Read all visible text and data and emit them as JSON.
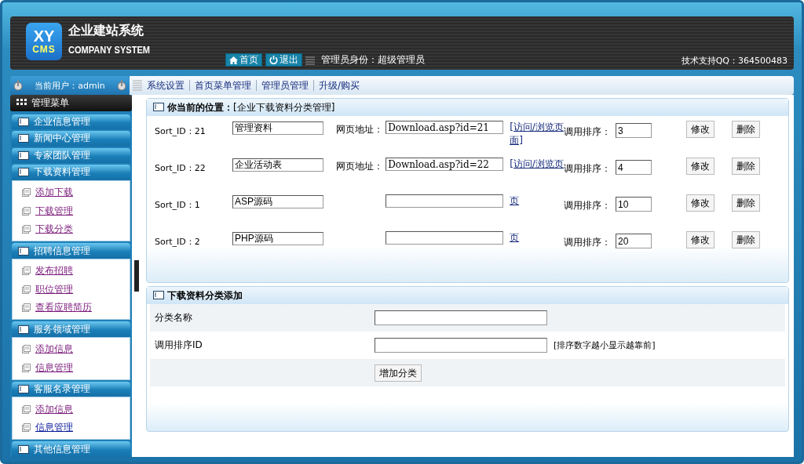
{
  "header": {
    "logo_top": "XY",
    "logo_bottom": "CMS",
    "title": "企业建站系统",
    "subtitle": "COMPANY SYSTEM",
    "buttons": [
      {
        "label": "首页",
        "kind": "home"
      },
      {
        "label": "退出",
        "kind": "power"
      }
    ],
    "admin_role": "管理员身份：超级管理员",
    "support": "技术支持QQ：364500483"
  },
  "current_user": "当前用户：admin",
  "top_nav": [
    "系统设置",
    "首页菜单管理",
    "管理员管理",
    "升级/购买"
  ],
  "sidebar": {
    "title": "管理菜单",
    "groups": [
      {
        "title": "企业信息管理",
        "expanded": false
      },
      {
        "title": "新闻中心管理",
        "expanded": false
      },
      {
        "title": "专家团队管理",
        "expanded": false
      },
      {
        "title": "下载资料管理",
        "expanded": true,
        "items": [
          {
            "label": "添加下载",
            "visited": true
          },
          {
            "label": "下载管理",
            "visited": true
          },
          {
            "label": "下载分类",
            "visited": true
          }
        ]
      },
      {
        "title": "招聘信息管理",
        "expanded": true,
        "items": [
          {
            "label": "发布招聘",
            "visited": true
          },
          {
            "label": "职位管理",
            "visited": true
          },
          {
            "label": "查看应聘简历",
            "visited": true
          }
        ]
      },
      {
        "title": "服务领域管理",
        "expanded": true,
        "items": [
          {
            "label": "添加信息",
            "visited": true
          },
          {
            "label": "信息管理",
            "visited": true
          }
        ]
      },
      {
        "title": "客服名录管理",
        "expanded": true,
        "items": [
          {
            "label": "添加信息",
            "visited": true
          },
          {
            "label": "信息管理",
            "visited": false
          }
        ]
      },
      {
        "title": "其他信息管理",
        "expanded": false
      }
    ]
  },
  "location": {
    "label": "你当前的位置：",
    "path": "[企业下载资料分类管理]"
  },
  "categories": [
    {
      "sort_id": "Sort_ID：21",
      "name": "管理资料",
      "url_label": "网页地址：",
      "url": "Download.asp?id=21",
      "link": "[访问/浏览页面]",
      "order_label": "调用排序：",
      "order": "3",
      "edit": "修改",
      "delete": "删除"
    },
    {
      "sort_id": "Sort_ID：22",
      "name": "企业活动表",
      "url_label": "网页地址：",
      "url": "Download.asp?id=22",
      "link": "[访问/浏览页",
      "order_label": "调用排序：",
      "order": "4",
      "edit": "修改",
      "delete": "删除"
    },
    {
      "sort_id": "Sort_ID：1",
      "name": "ASP源码",
      "link": "页",
      "order_label": "调用排序：",
      "order": "10",
      "edit": "修改",
      "delete": "删除"
    },
    {
      "sort_id": "Sort_ID：2",
      "name": "PHP源码",
      "link": "页",
      "order_label": "调用排序：",
      "order": "20",
      "edit": "修改",
      "delete": "删除"
    }
  ],
  "add_form": {
    "title": "下载资料分类添加",
    "fields": [
      {
        "label": "分类名称"
      },
      {
        "label": "调用排序ID",
        "hint": "[排序数字越小显示越靠前]"
      }
    ],
    "submit": "增加分类"
  }
}
